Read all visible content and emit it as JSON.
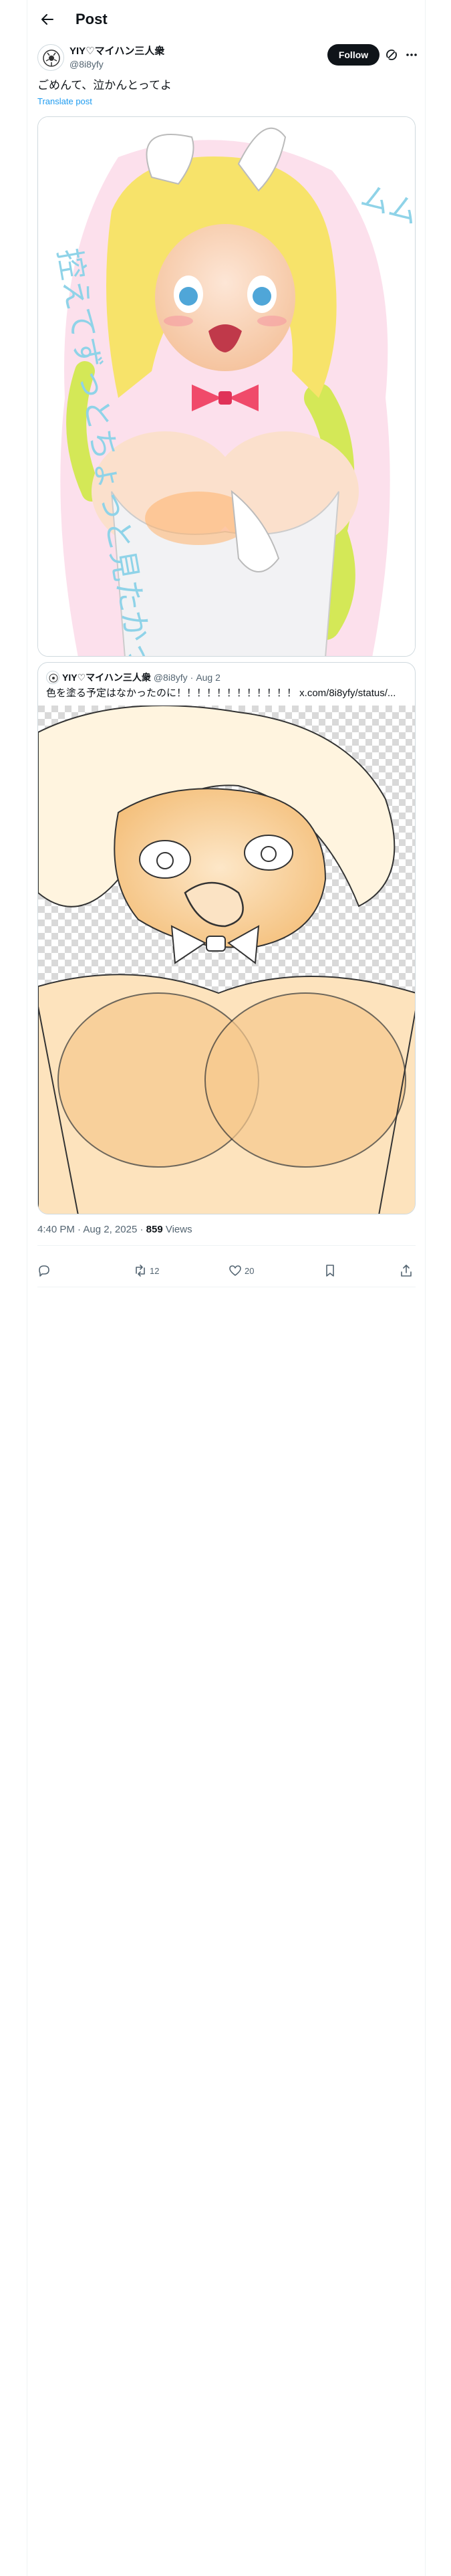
{
  "header": {
    "title": "Post"
  },
  "post": {
    "author_name": "YIY♡マイハン三人衆",
    "author_handle": "@8i8yfy",
    "follow_label": "Follow",
    "text": "ごめんて、泣かんとってよ",
    "translate_label": "Translate post",
    "time": "4:40 PM",
    "date": "Aug 2, 2025",
    "separator": "·",
    "views_count": "859",
    "views_label": "Views"
  },
  "media_text": {
    "main_speech_right": "ムムッッッ",
    "main_speech_left": "控えてずっとちょっと見たかったっッ"
  },
  "quote": {
    "author_name": "YIY♡マイハン三人衆",
    "author_handle": "@8i8yfy",
    "date": "Aug 2",
    "separator": "·",
    "text": "色を塗る予定はなかったのに！！！！！！！！！！！！ x.com/8i8yfy/status/..."
  },
  "actions": {
    "reply_count": "",
    "repost_count": "12",
    "like_count": "20"
  },
  "colors": {
    "text_primary": "#0f1419",
    "text_secondary": "#536471",
    "link": "#1d9bf0",
    "border": "#cfd9de",
    "follow_bg": "#0f1419"
  },
  "icons": [
    "back-arrow-icon",
    "grok-icon",
    "more-icon",
    "reply-icon",
    "repost-icon",
    "like-icon",
    "bookmark-icon",
    "share-icon"
  ]
}
